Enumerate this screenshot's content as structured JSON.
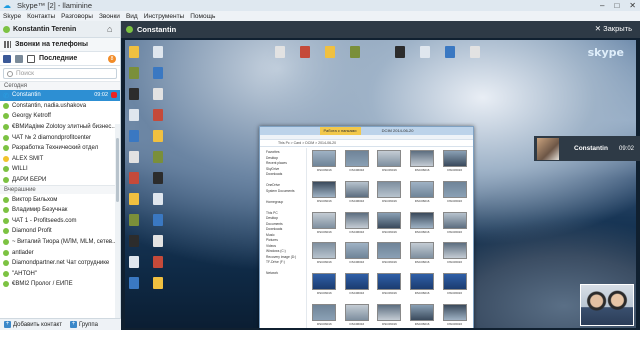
{
  "window": {
    "title": "Skype™ [2] - llaminine"
  },
  "menu": [
    "Skype",
    "Контакты",
    "Разговоры",
    "Звонки",
    "Вид",
    "Инструменты",
    "Помощь"
  ],
  "profile": {
    "name": "Konstantin Terenin"
  },
  "call_phones": {
    "label": "Звонки на телефоны"
  },
  "tabs": {
    "recent_label": "Последние",
    "badge": "8"
  },
  "search": {
    "placeholder": "Поиск"
  },
  "groups": [
    {
      "header": "Сегодня",
      "items": [
        {
          "name": "Constantin",
          "time": "09:02",
          "status": "phone",
          "selected": true
        },
        {
          "name": "Constantin, nadia.ushakova",
          "status": "online"
        },
        {
          "name": "Georgy Ketroff",
          "status": "online"
        },
        {
          "name": "€ВМИадіме Zolotoy злитный бизнес...",
          "status": "online"
        },
        {
          "name": "ЧАТ № 2 diamondprofitcenter",
          "status": "online"
        },
        {
          "name": "Разработка Технический отдел",
          "status": "online"
        },
        {
          "name": "ALEX SMIT",
          "status": "away"
        },
        {
          "name": "WILLI",
          "status": "online"
        },
        {
          "name": "ДАРИ БЕРИ",
          "status": "online"
        }
      ]
    },
    {
      "header": "Вчерашние",
      "items": [
        {
          "name": "Виктор Бильхом",
          "status": "online"
        },
        {
          "name": "Владимир Безучнак",
          "status": "online"
        },
        {
          "name": "ЧАТ 1 - Profitseeds.com",
          "status": "online"
        },
        {
          "name": "Diamond Profit",
          "status": "online"
        },
        {
          "name": "~ Виталий Тиора (МЛМ, MLM, сетев...",
          "status": "online"
        },
        {
          "name": "antlader",
          "status": "online"
        },
        {
          "name": "Diamondpartner.net Чат сотруднике",
          "status": "online"
        },
        {
          "name": "\"АНТОН\"",
          "status": "online"
        },
        {
          "name": "€ВМІ2 Пролог / ЕИПЕ",
          "status": "online"
        }
      ]
    }
  ],
  "bottom": {
    "add_contact": "Добавить контакт",
    "group": "Группа"
  },
  "call": {
    "name": "Constantin",
    "close_label": "Закрыть",
    "card_name": "Constantin",
    "card_time": "09:02"
  },
  "desktop": {
    "watermark": "skype"
  },
  "explorer": {
    "title": "DCIM 2014-06-20",
    "tab": "Работа с папками",
    "address": "This Pc > Card > DCIM > 2014-06-20",
    "nav": [
      "Favorites",
      "Desktop",
      "Recent places",
      "SkyDrive",
      "Downloads",
      "",
      "OneDrive",
      "System Documents",
      "",
      "Homegroup",
      "",
      "This PC",
      "Desktop",
      "Documents",
      "Downloads",
      "Music",
      "Pictures",
      "Videos",
      "Windows (C:)",
      "Recovery image (D:)",
      "TF-Drive (F:)",
      "",
      "Network"
    ],
    "thumb_caption": "DSC06016",
    "thumb_count": 30
  },
  "colors": {
    "accent": "#2d8fd3",
    "online": "#7cc242",
    "titlebar": "#dfe8f0",
    "call_header": "#2e3a46"
  }
}
